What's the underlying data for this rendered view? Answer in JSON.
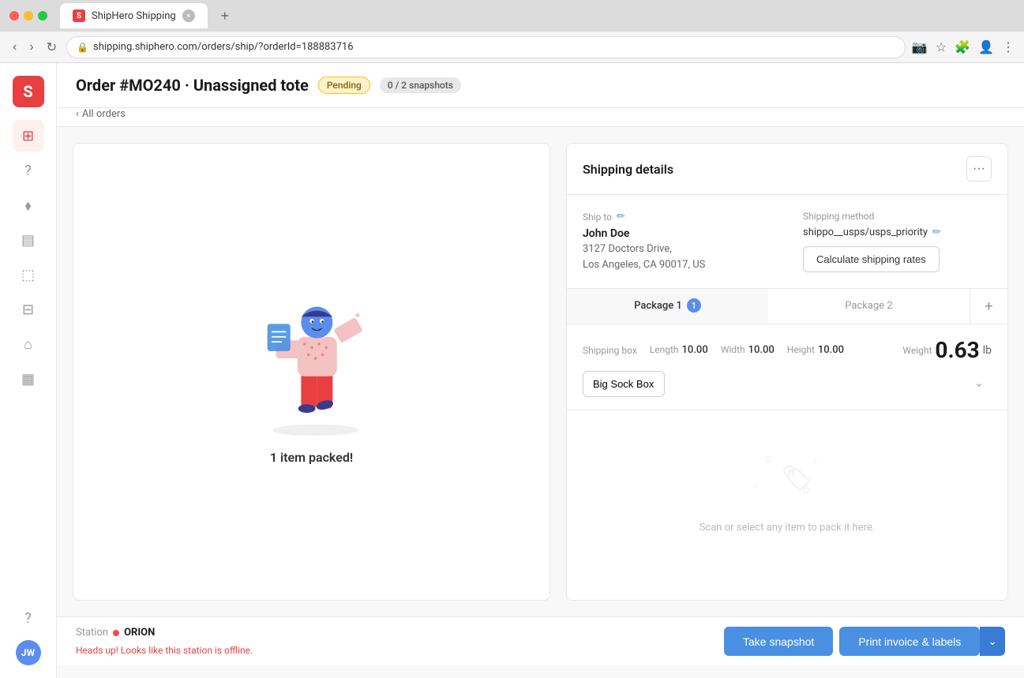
{
  "browser": {
    "url": "shipping.shiphero.com/orders/ship/?orderId=188883716",
    "tab_title": "ShipHero Shipping",
    "tab_favicon": "S"
  },
  "page": {
    "title": "Order #MO240 · Unassigned tote",
    "status_pending": "Pending",
    "snapshots": "0 / 2 snapshots",
    "back_link": "All orders"
  },
  "left_panel": {
    "packed_text": "1 item packed!"
  },
  "shipping_details": {
    "panel_title": "Shipping details",
    "ship_to_label": "Ship to",
    "customer_name": "John Doe",
    "customer_address_line1": "3127 Doctors Drive,",
    "customer_address_line2": "Los Angeles, CA 90017, US",
    "shipping_method_label": "Shipping method",
    "shipping_method_value": "shippo__usps/usps_priority",
    "calc_btn_label": "Calculate shipping rates"
  },
  "packages": {
    "tab1_label": "Package 1",
    "tab1_count": "1",
    "tab2_label": "Package 2",
    "add_icon": "+"
  },
  "shipping_box": {
    "label": "Shipping box",
    "length_label": "Length",
    "length_value": "10.00",
    "width_label": "Width",
    "width_value": "10.00",
    "height_label": "Height",
    "height_value": "10.00",
    "weight_label": "Weight",
    "weight_value": "0.63",
    "weight_unit": "lb",
    "box_name": "Big Sock Box"
  },
  "scan_area": {
    "text": "Scan or select any item to pack it here."
  },
  "footer": {
    "station_label": "Station",
    "station_name": "ORION",
    "offline_msg": "Heads up! Looks like this station is offline.",
    "snapshot_btn": "Take snapshot",
    "print_btn": "Print invoice & labels"
  },
  "sidebar": {
    "logo_letter": "S",
    "avatar_initials": "JW",
    "items": [
      {
        "icon": "⊞",
        "name": "dashboard"
      },
      {
        "icon": "?",
        "name": "help"
      },
      {
        "icon": "⬧",
        "name": "tags"
      },
      {
        "icon": "▤",
        "name": "orders"
      },
      {
        "icon": "⬚",
        "name": "shipping"
      },
      {
        "icon": "⊟",
        "name": "inventory"
      },
      {
        "icon": "⌂",
        "name": "warehouse"
      },
      {
        "icon": "▦",
        "name": "reports"
      },
      {
        "icon": "?",
        "name": "support"
      }
    ]
  }
}
